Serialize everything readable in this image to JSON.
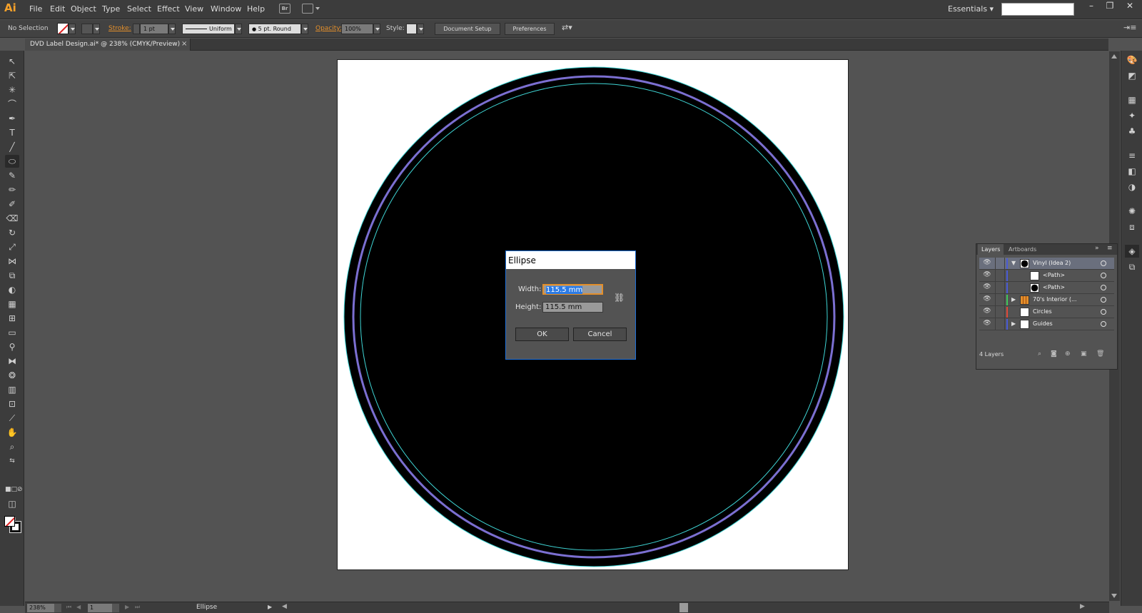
{
  "app": {
    "logo": "Ai",
    "menu": [
      "File",
      "Edit",
      "Object",
      "Type",
      "Select",
      "Effect",
      "View",
      "Window",
      "Help"
    ],
    "bridge_label": "Br",
    "workspace": "Essentials",
    "window_controls": [
      "minimize",
      "restore",
      "close"
    ]
  },
  "control_bar": {
    "selection_status": "No Selection",
    "stroke_label": "Stroke:",
    "stroke_weight": "1 pt",
    "stroke_profile": "Uniform",
    "brush": "5 pt. Round",
    "opacity_label": "Opacity:",
    "opacity_value": "100%",
    "style_label": "Style:",
    "document_setup": "Document Setup",
    "preferences": "Preferences"
  },
  "document": {
    "tab_title": "DVD Label Design.ai* @ 238% (CMYK/Preview)",
    "close_glyph": "×"
  },
  "dialog": {
    "title": "Ellipse",
    "width_label": "Width:",
    "width_value": "115.5 mm",
    "height_label": "Height:",
    "height_value": "115.5 mm",
    "ok_label": "OK",
    "cancel_label": "Cancel"
  },
  "layers_panel": {
    "tabs": [
      "Layers",
      "Artboards"
    ],
    "rows": [
      {
        "name": "Vinyl (Idea 2)",
        "color": "#4a5bd6",
        "expander": "▼",
        "thumb": "black-circle",
        "selected": true
      },
      {
        "name": "<Path>",
        "color": "#4a5bd6",
        "expander": "",
        "thumb": "white",
        "selected": false
      },
      {
        "name": "<Path>",
        "color": "#4a5bd6",
        "expander": "",
        "thumb": "black-circle",
        "selected": false
      },
      {
        "name": "70's Interior (...",
        "color": "#41c85c",
        "expander": "▶",
        "thumb": "orange-grid",
        "selected": false
      },
      {
        "name": "Circles",
        "color": "#e04a3a",
        "expander": "",
        "thumb": "white",
        "selected": false
      },
      {
        "name": "Guides",
        "color": "#4a5bd6",
        "expander": "▶",
        "thumb": "white",
        "selected": false
      }
    ],
    "count_label": "4 Layers"
  },
  "status_bar": {
    "zoom": "238%",
    "page": "1",
    "current_tool": "Ellipse"
  },
  "colors": {
    "accent_orange": "#e38f2b",
    "selection_blue": "#2c7be5",
    "ring_purple": "#7b6fd1",
    "guide_cyan": "#3fd6d6"
  }
}
